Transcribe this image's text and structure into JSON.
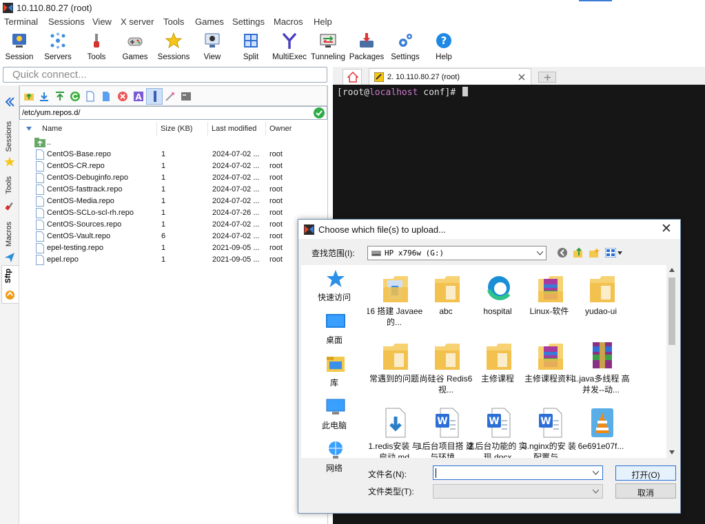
{
  "window": {
    "title": "10.110.80.27 (root)"
  },
  "menu": [
    "Terminal",
    "Sessions",
    "View",
    "X server",
    "Tools",
    "Games",
    "Settings",
    "Macros",
    "Help"
  ],
  "toolbar": [
    "Session",
    "Servers",
    "Tools",
    "Games",
    "Sessions",
    "View",
    "Split",
    "MultiExec",
    "Tunneling",
    "Packages",
    "Settings",
    "Help"
  ],
  "quick_connect": {
    "placeholder": "Quick connect..."
  },
  "side_tabs": [
    "Sessions",
    "Tools",
    "Macros",
    "Sftp"
  ],
  "sftp": {
    "path": "/etc/yum.repos.d/",
    "columns": [
      "Name",
      "Size (KB)",
      "Last modified",
      "Owner"
    ],
    "parent": "..",
    "files": [
      {
        "name": "CentOS-Base.repo",
        "size": "1",
        "modified": "2024-07-02 ...",
        "owner": "root"
      },
      {
        "name": "CentOS-CR.repo",
        "size": "1",
        "modified": "2024-07-02 ...",
        "owner": "root"
      },
      {
        "name": "CentOS-Debuginfo.repo",
        "size": "1",
        "modified": "2024-07-02 ...",
        "owner": "root"
      },
      {
        "name": "CentOS-fasttrack.repo",
        "size": "1",
        "modified": "2024-07-02 ...",
        "owner": "root"
      },
      {
        "name": "CentOS-Media.repo",
        "size": "1",
        "modified": "2024-07-02 ...",
        "owner": "root"
      },
      {
        "name": "CentOS-SCLo-scl-rh.repo",
        "size": "1",
        "modified": "2024-07-26 ...",
        "owner": "root"
      },
      {
        "name": "CentOS-Sources.repo",
        "size": "1",
        "modified": "2024-07-02 ...",
        "owner": "root"
      },
      {
        "name": "CentOS-Vault.repo",
        "size": "6",
        "modified": "2024-07-02 ...",
        "owner": "root"
      },
      {
        "name": "epel-testing.repo",
        "size": "1",
        "modified": "2021-09-05 ...",
        "owner": "root"
      },
      {
        "name": "epel.repo",
        "size": "1",
        "modified": "2021-09-05 ...",
        "owner": "root"
      }
    ]
  },
  "terminal": {
    "tab_label": "2. 10.110.80.27 (root)",
    "prompt_user": "[root@",
    "prompt_host": "localhost",
    "prompt_rest": " conf]#"
  },
  "dialog": {
    "title": "Choose which file(s) to upload...",
    "look_in_label": "查找范围(I):",
    "look_in_value": "HP x796w (G:)",
    "places": [
      "快速访问",
      "桌面",
      "库",
      "此电脑",
      "网络"
    ],
    "items": [
      {
        "name": "16 搭建 Javaee的...",
        "kind": "folder-doc"
      },
      {
        "name": "abc",
        "kind": "folder"
      },
      {
        "name": "hospital",
        "kind": "edge"
      },
      {
        "name": "Linux-软件",
        "kind": "folder-rar"
      },
      {
        "name": "yudao-ui",
        "kind": "folder"
      },
      {
        "name": "常遇到的问题",
        "kind": "folder"
      },
      {
        "name": "尚硅谷 Redis6视...",
        "kind": "folder"
      },
      {
        "name": "主修课程",
        "kind": "folder"
      },
      {
        "name": "主修课程资料",
        "kind": "folder-rar"
      },
      {
        "name": "1.java多线程 高并发--动...",
        "kind": "rar"
      },
      {
        "name": "1.redis安装 与启动.md",
        "kind": "download"
      },
      {
        "name": "1后台项目搭 建与环境...",
        "kind": "word"
      },
      {
        "name": "2.后台功能的 实现.docx",
        "kind": "word"
      },
      {
        "name": "3.nginx的安 装配置与...",
        "kind": "word"
      },
      {
        "name": "6e691e07f...",
        "kind": "vlc"
      }
    ],
    "filename_label": "文件名(N):",
    "filename_value": "",
    "filetype_label": "文件类型(T):",
    "open_button": "打开(O)",
    "cancel_button": "取消"
  }
}
